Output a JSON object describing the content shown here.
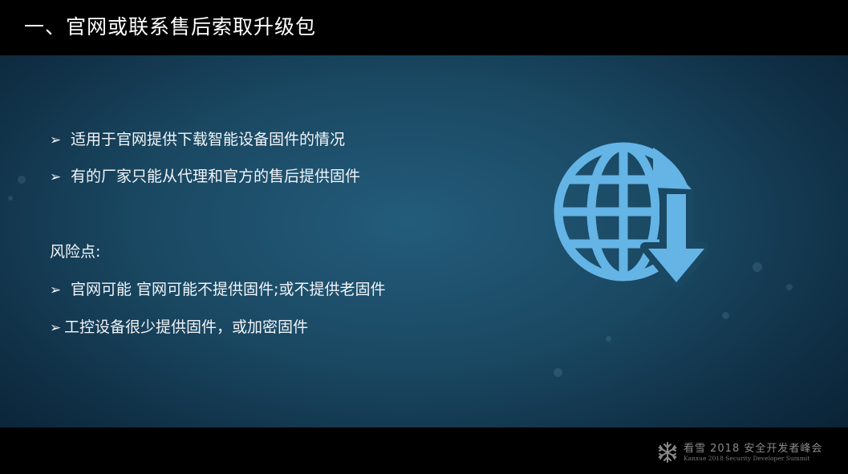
{
  "slide": {
    "title": "一、官网或联系售后索取升级包",
    "bullets": [
      {
        "marker": "➢",
        "text": "适用于官网提供下载智能设备固件的情况"
      },
      {
        "marker": "➢",
        "text": "有的厂家只能从代理和官方的售后提供固件"
      }
    ],
    "risk_heading": "风险点:",
    "risks": [
      {
        "marker": "➢",
        "text": "官网可能  官网可能不提供固件;或不提供老固件"
      },
      {
        "marker": "➢",
        "text": "工控设备很少提供固件，或加密固件"
      }
    ],
    "illustration_icon": "globe-download-icon",
    "colors": {
      "title_bar": "#000000",
      "background_center": "#235c7b",
      "background_edge": "#0a2235",
      "text": "#f2f5f8",
      "icon": "#64b4e6"
    }
  },
  "footer": {
    "logo_icon": "snowflake-icon",
    "logo_line1": "看雪 2018 安全开发者峰会",
    "logo_line2": "Kanxue 2018 Security Developer Summit"
  }
}
